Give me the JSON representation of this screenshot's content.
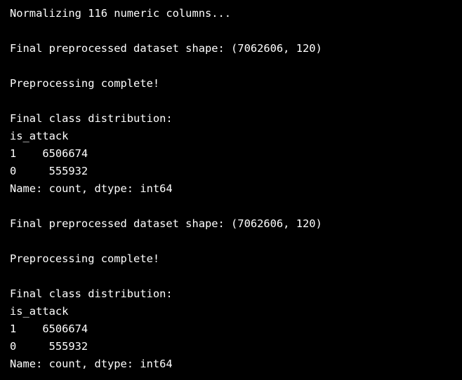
{
  "terminal": {
    "background": "#000000",
    "foreground": "#ffffff",
    "lines": [
      "Normalizing 116 numeric columns...",
      "",
      "Final preprocessed dataset shape: (7062606, 120)",
      "",
      "Preprocessing complete!",
      "",
      "Final class distribution:",
      "is_attack",
      "1    6506674",
      "0     555932",
      "Name: count, dtype: int64",
      "",
      "Final preprocessed dataset shape: (7062606, 120)",
      "",
      "Preprocessing complete!",
      "",
      "Final class distribution:",
      "is_attack",
      "1    6506674",
      "0     555932",
      "Name: count, dtype: int64"
    ]
  }
}
